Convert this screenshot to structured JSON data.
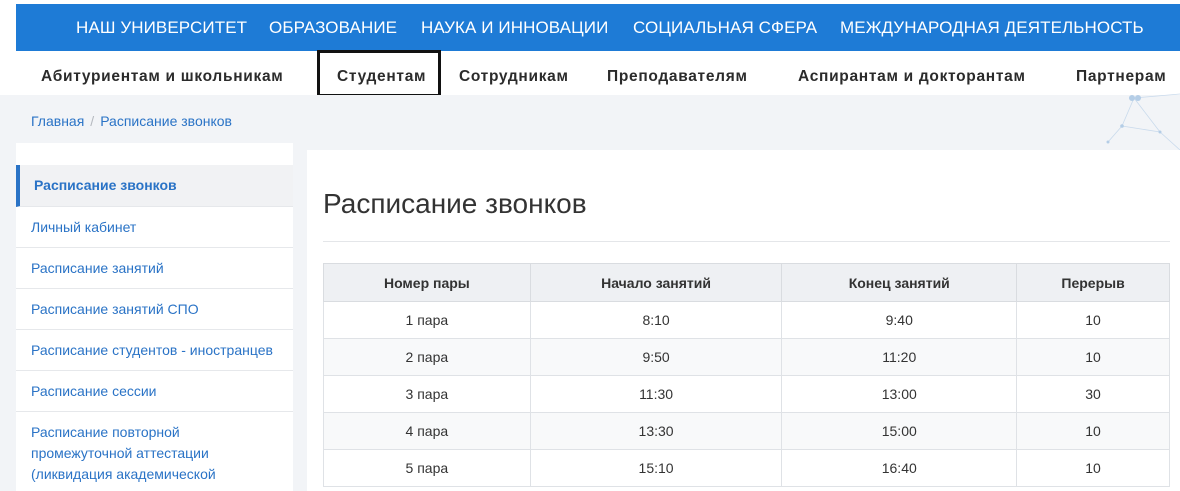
{
  "top_nav": {
    "items": [
      "НАШ УНИВЕРСИТЕТ",
      "ОБРАЗОВАНИЕ",
      "НАУКА И ИННОВАЦИИ",
      "СОЦИАЛЬНАЯ СФЕРА",
      "МЕЖДУНАРОДНАЯ ДЕЯТЕЛЬНОСТЬ"
    ]
  },
  "sub_nav": {
    "items": [
      "Абитуриентам и школьникам",
      "Студентам",
      "Сотрудникам",
      "Преподавателям",
      "Аспирантам и докторантам",
      "Партнерам"
    ],
    "highlighted": "Студентам"
  },
  "breadcrumb": {
    "home": "Главная",
    "separator": "/",
    "current": "Расписание звонков"
  },
  "sidebar": {
    "items": [
      "Расписание звонков",
      "Личный кабинет",
      "Расписание занятий",
      "Расписание занятий СПО",
      "Расписание студентов - иностранцев",
      "Расписание сессии",
      "Расписание повторной промежуточной аттестации (ликвидация академической"
    ],
    "active": "Расписание звонков"
  },
  "main": {
    "title": "Расписание звонков",
    "table": {
      "headers": [
        "Номер пары",
        "Начало занятий",
        "Конец занятий",
        "Перерыв"
      ],
      "rows": [
        [
          "1 пара",
          "8:10",
          "9:40",
          "10"
        ],
        [
          "2 пара",
          "9:50",
          "11:20",
          "10"
        ],
        [
          "3 пара",
          "11:30",
          "13:00",
          "30"
        ],
        [
          "4 пара",
          "13:30",
          "15:00",
          "10"
        ],
        [
          "5 пара",
          "15:10",
          "16:40",
          "10"
        ]
      ]
    }
  },
  "colors": {
    "nav_blue": "#1e7bd6",
    "link_blue": "#2a73c6",
    "page_grey": "#f2f4f7"
  }
}
